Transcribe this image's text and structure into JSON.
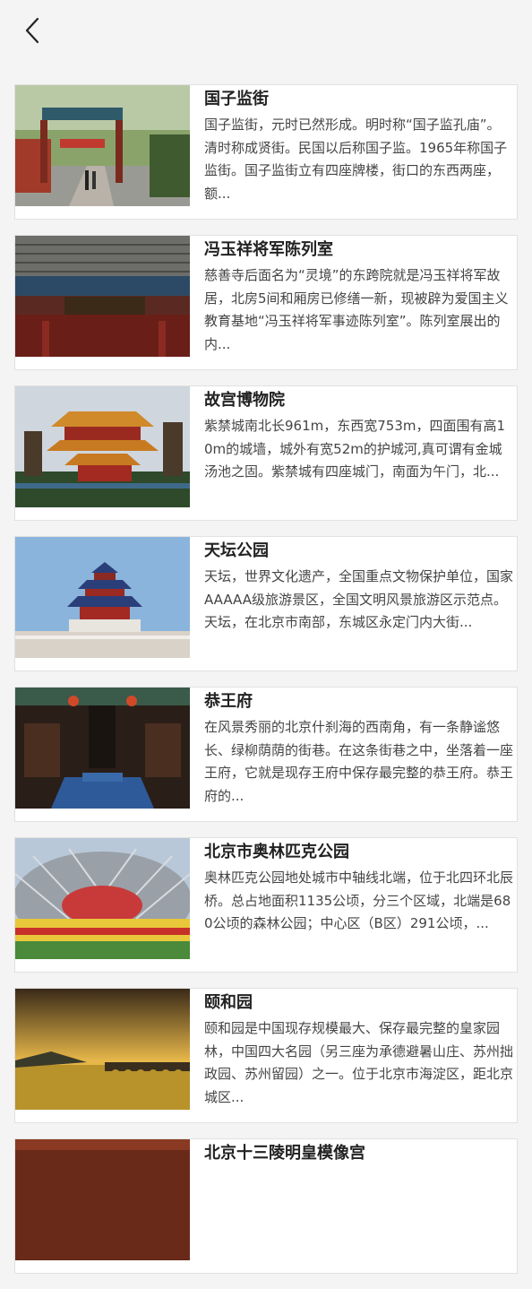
{
  "header": {
    "back_icon": "chevron-left-icon"
  },
  "items": [
    {
      "title": "国子监街",
      "desc": "国子监街，元时已然形成。明时称“国子监孔庙”。清时称成贤街。民国以后称国子监。1965年称国子监街。国子监街立有四座牌楼，街口的东西两座，额..."
    },
    {
      "title": "冯玉祥将军陈列室",
      "desc": "慈善寺后面名为“灵境”的东跨院就是冯玉祥将军故居，北房5间和厢房已修缮一新，现被辟为爱国主义教育基地“冯玉祥将军事迹陈列室”。陈列室展出的内..."
    },
    {
      "title": "故宫博物院",
      "desc": "紫禁城南北长961m，东西宽753m，四面围有高10m的城墙，城外有宽52m的护城河,真可谓有金城汤池之固。紫禁城有四座城门，南面为午门，北..."
    },
    {
      "title": "天坛公园",
      "desc": "天坛，世界文化遗产，全国重点文物保护单位，国家AAAAA级旅游景区，全国文明风景旅游区示范点。 天坛，在北京市南部，东城区永定门内大街..."
    },
    {
      "title": "恭王府",
      "desc": "在风景秀丽的北京什刹海的西南角，有一条静谧悠长、绿柳荫荫的街巷。在这条街巷之中，坐落着一座王府，它就是现存王府中保存最完整的恭王府。恭王府的..."
    },
    {
      "title": "北京市奥林匹克公园",
      "desc": "奥林匹克公园地处城市中轴线北端，位于北四环北辰桥。总占地面积1135公顷，分三个区域，北端是680公顷的森林公园；中心区（B区）291公顷，..."
    },
    {
      "title": "颐和园",
      "desc": "颐和园是中国现存规模最大、保存最完整的皇家园林，中国四大名园（另三座为承德避暑山庄、苏州拙政园、苏州留园）之一。位于北京市海淀区，距北京城区..."
    },
    {
      "title": "北京十三陵明皇模像宫",
      "desc": ""
    }
  ]
}
